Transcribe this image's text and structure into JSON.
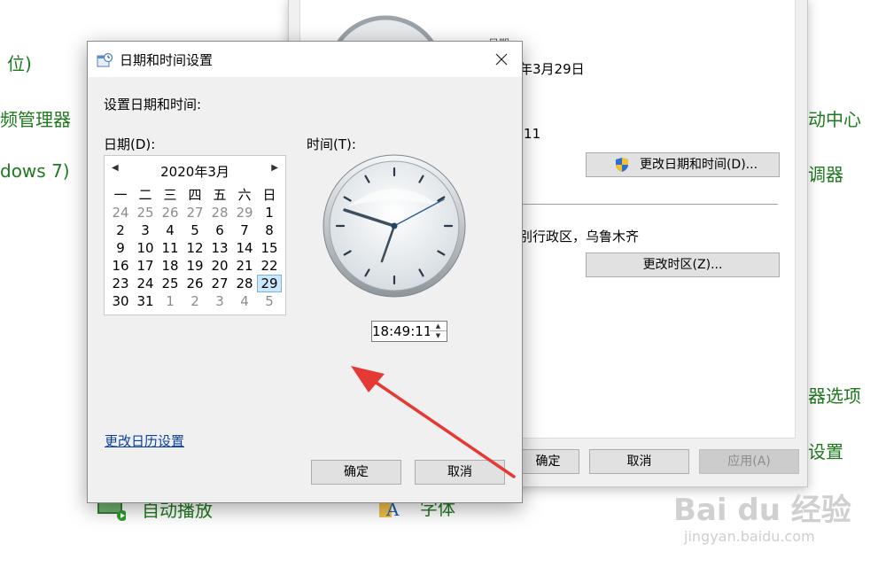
{
  "background": {
    "links": [
      "位)",
      "频管理器",
      "dows 7)",
      "自动播放",
      "字体",
      "动中心",
      "调器",
      "器选项",
      "设置"
    ],
    "dialog": {
      "date_label": "日期:",
      "date_value": "年3月29日",
      "time_value": ":11",
      "change_datetime_button": "更改日期和时间(D)...",
      "timezone_value": "别行政区，乌鲁木齐",
      "change_timezone_button": "更改时区(Z)...",
      "ok_button": "确定",
      "cancel_button": "取消",
      "apply_button": "应用(A)"
    }
  },
  "dialog": {
    "title": "日期和时间设置",
    "heading": "设置日期和时间:",
    "date_label": "日期(D):",
    "time_label": "时间(T):",
    "calendar": {
      "month_title": "2020年3月",
      "weekdays": [
        "一",
        "二",
        "三",
        "四",
        "五",
        "六",
        "日"
      ],
      "weeks": [
        [
          "24",
          "25",
          "26",
          "27",
          "28",
          "29",
          "1"
        ],
        [
          "2",
          "3",
          "4",
          "5",
          "6",
          "7",
          "8"
        ],
        [
          "9",
          "10",
          "11",
          "12",
          "13",
          "14",
          "15"
        ],
        [
          "16",
          "17",
          "18",
          "19",
          "20",
          "21",
          "22"
        ],
        [
          "23",
          "24",
          "25",
          "26",
          "27",
          "28",
          "29"
        ],
        [
          "30",
          "31",
          "1",
          "2",
          "3",
          "4",
          "5"
        ]
      ],
      "selected_day": "29"
    },
    "time_value": "18:49:11",
    "change_calendar_link": "更改日历设置",
    "ok_button": "确定",
    "cancel_button": "取消"
  },
  "watermark": {
    "brand": "Bai du 经验",
    "url": "jingyan.baidu.com"
  }
}
